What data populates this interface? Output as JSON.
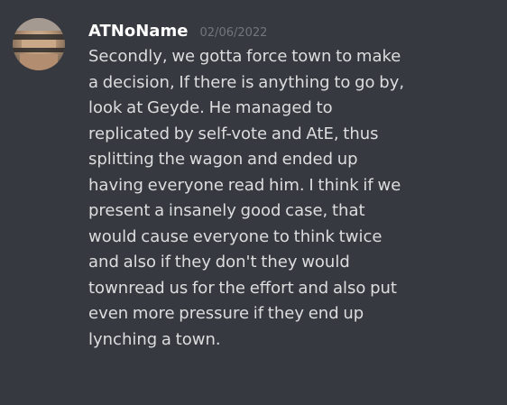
{
  "message": {
    "author": "ATNoName",
    "timestamp": "02/06/2022",
    "avatar_icon": "user-avatar-icon",
    "lines": [
      "Secondly, we gotta force town to make",
      "a decision, If there is anything to go by,",
      "look at Geyde. He managed to",
      "replicated by self-vote and AtE, thus",
      "splitting the wagon and ended up",
      "having everyone read him. I think if we",
      "present a insanely good case, that",
      "would cause everyone to think twice",
      "and also if they don't they would",
      "townread us for the effort and also put",
      "even more pressure if they end up",
      "lynching a town."
    ]
  },
  "colors": {
    "background": "#36393f",
    "username": "#ffffff",
    "timestamp": "#72767d",
    "text": "#dcddde"
  }
}
